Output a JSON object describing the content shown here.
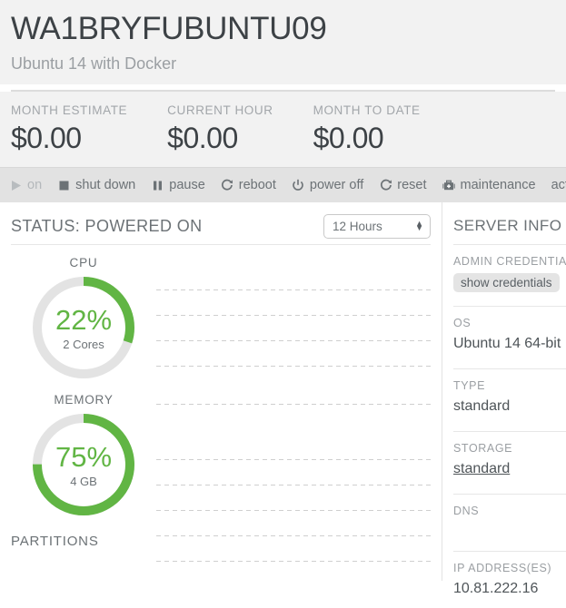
{
  "header": {
    "title": "WA1BRYFUBUNTU09",
    "subtitle": "Ubuntu 14 with Docker"
  },
  "stats": [
    {
      "label": "MONTH ESTIMATE",
      "value": "$0.00"
    },
    {
      "label": "CURRENT HOUR",
      "value": "$0.00"
    },
    {
      "label": "MONTH TO DATE",
      "value": "$0.00"
    }
  ],
  "toolbar": {
    "items": [
      {
        "label": "on",
        "icon": "play-icon",
        "disabled": true
      },
      {
        "label": "shut down",
        "icon": "stop-square-icon",
        "disabled": false
      },
      {
        "label": "pause",
        "icon": "pause-icon",
        "disabled": false
      },
      {
        "label": "reboot",
        "icon": "refresh-icon",
        "disabled": false
      },
      {
        "label": "power off",
        "icon": "power-icon",
        "disabled": false
      },
      {
        "label": "reset",
        "icon": "refresh-icon",
        "disabled": false
      },
      {
        "label": "maintenance",
        "icon": "toolbox-icon",
        "disabled": false
      }
    ],
    "action_label": "action",
    "action_icon": "chevron-down-icon"
  },
  "status": {
    "text": "STATUS: POWERED ON",
    "range_value": "12 Hours",
    "range_options": [
      "12 Hours"
    ]
  },
  "gauges": [
    {
      "title": "CPU",
      "percent_label": "22%",
      "percent": 22,
      "arc_fraction": 0.3,
      "sub": "2 Cores"
    },
    {
      "title": "MEMORY",
      "percent_label": "75%",
      "percent": 75,
      "arc_fraction": 0.75,
      "sub": "4 GB"
    }
  ],
  "partitions": {
    "title": "PARTITIONS"
  },
  "chart_data": {
    "type": "line",
    "title": "",
    "xlabel": "",
    "ylabel": "",
    "series": [],
    "grid": true,
    "gridline_count": 10,
    "legend": "none",
    "note": "empty plot area: only dashed horizontal gridlines, no data plotted"
  },
  "sidebar": {
    "title": "SERVER INFO",
    "credentials": {
      "label": "ADMIN CREDENTIALS",
      "button_label": "show credentials"
    },
    "fields": [
      {
        "label": "OS",
        "value": "Ubuntu 14 64-bit",
        "link": false
      },
      {
        "label": "TYPE",
        "value": "standard",
        "link": false
      },
      {
        "label": "STORAGE",
        "value": "standard",
        "link": true
      },
      {
        "label": "DNS",
        "value": "",
        "link": false
      },
      {
        "label": "IP ADDRESS(ES)",
        "value": "10.81.222.16",
        "link": false
      }
    ]
  },
  "colors": {
    "green": "#61b544",
    "track": "#e3e3e3",
    "header_bg": "#f2f2f2",
    "toolbar_bg": "#e2e2e2",
    "text": "#6c7276"
  }
}
